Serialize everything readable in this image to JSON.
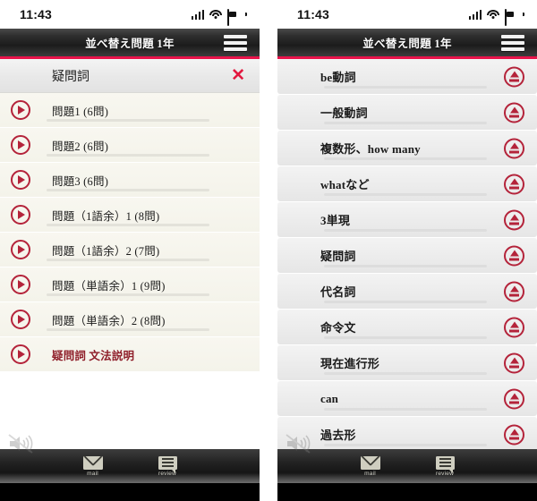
{
  "status_bar": {
    "time": "11:43",
    "icons": [
      "signal-icon",
      "wifi-icon",
      "battery-icon"
    ]
  },
  "app_header": {
    "title": "並べ替え問題 1年",
    "menu_icon": "hamburger-menu-icon"
  },
  "left_screen": {
    "section_header": {
      "label": "疑問詞",
      "close_icon": "close-x-icon"
    },
    "items": [
      {
        "label": "問題1 (6問)",
        "icon": "play-icon",
        "accent": false
      },
      {
        "label": "問題2 (6問)",
        "icon": "play-icon",
        "accent": false
      },
      {
        "label": "問題3 (6問)",
        "icon": "play-icon",
        "accent": false
      },
      {
        "label": "問題（1語余）1 (8問)",
        "icon": "play-icon",
        "accent": false
      },
      {
        "label": "問題（1語余）2 (7問)",
        "icon": "play-icon",
        "accent": false
      },
      {
        "label": "問題（単語余）1 (9問)",
        "icon": "play-icon",
        "accent": false
      },
      {
        "label": "問題（単語余）2 (8問)",
        "icon": "play-icon",
        "accent": false
      },
      {
        "label": "疑問詞 文法説明",
        "icon": "play-icon",
        "accent": true
      }
    ],
    "mute_icon": "speaker-mute-icon"
  },
  "right_screen": {
    "items": [
      {
        "label": "be動詞",
        "icon": "eject-icon"
      },
      {
        "label": "一般動詞",
        "icon": "eject-icon"
      },
      {
        "label": "複数形、how many",
        "icon": "eject-icon"
      },
      {
        "label": "whatなど",
        "icon": "eject-icon"
      },
      {
        "label": "3単現",
        "icon": "eject-icon"
      },
      {
        "label": "疑問詞",
        "icon": "eject-icon"
      },
      {
        "label": "代名詞",
        "icon": "eject-icon"
      },
      {
        "label": "命令文",
        "icon": "eject-icon"
      },
      {
        "label": "現在進行形",
        "icon": "eject-icon"
      },
      {
        "label": "can",
        "icon": "eject-icon"
      },
      {
        "label": "過去形",
        "icon": "eject-icon"
      }
    ],
    "mute_icon": "speaker-mute-icon"
  },
  "tab_bar": {
    "tabs": [
      {
        "label": "mail",
        "icon": "mail-envelope-icon"
      },
      {
        "label": "review",
        "icon": "review-lines-icon"
      }
    ]
  },
  "colors": {
    "accent_red": "#e8134a",
    "icon_red": "#b4233a",
    "accent_text": "#8f1f2a",
    "header_dark": "#1c1c1c",
    "left_row_bg": "#f6f5ee",
    "right_row_bg": "#ededed"
  }
}
